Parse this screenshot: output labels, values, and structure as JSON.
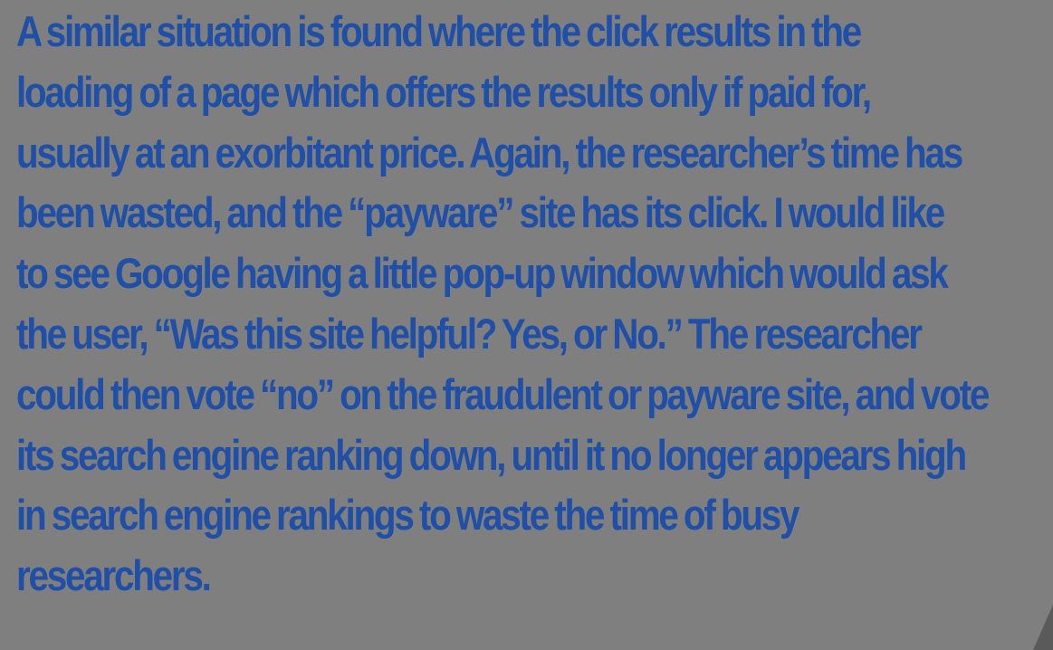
{
  "document": {
    "lines": [
      "A similar situation is found where the click results in the",
      "loading of a page which offers the results only if paid for,",
      "usually at an exorbitant price. Again, the researcher’s time has",
      "been wasted, and the “payware” site has its click. I would like",
      "to see Google having a little pop-up window which would ask",
      "the user, “Was this site helpful? Yes, or No.” The researcher",
      "could then vote “no” on the fraudulent or payware site, and vote",
      "its search engine ranking down, until it no longer appears high",
      "in search engine rankings to waste the time of busy",
      "researchers."
    ]
  },
  "colors": {
    "background": "#7f7f7f",
    "text": "#1f4fa6"
  }
}
